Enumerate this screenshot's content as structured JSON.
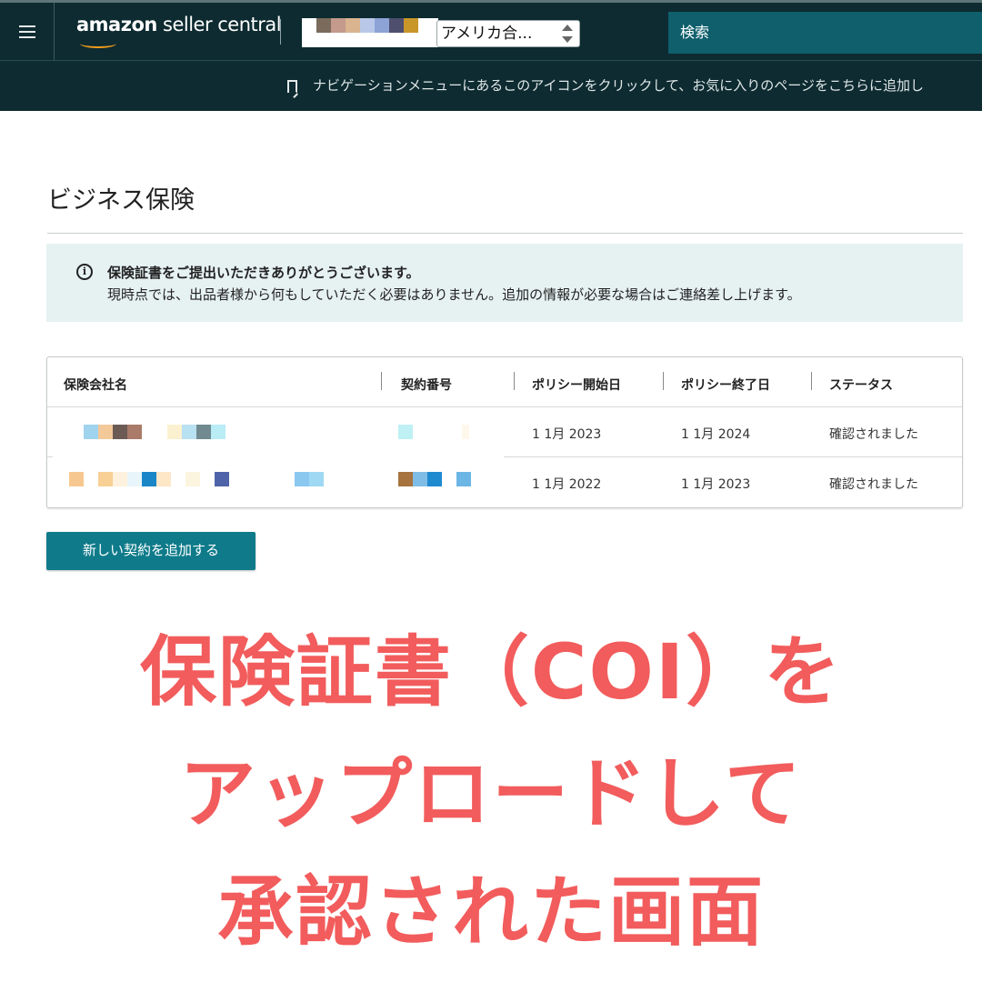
{
  "header": {
    "logo_bold": "amazon",
    "logo_rest": " seller central",
    "marketplace": "アメリカ合...",
    "search_placeholder": "検索"
  },
  "favorites_bar": {
    "hint": "ナビゲーションメニューにあるこのアイコンをクリックして、お気に入りのページをこちらに追加し"
  },
  "page": {
    "title": "ビジネス保険"
  },
  "alert": {
    "title": "保険証書をご提出いただきありがとうございます。",
    "body": "現時点では、出品者様から何もしていただく必要はありません。追加の情報が必要な場合はご連絡差し上げます。"
  },
  "table": {
    "headers": [
      "保険会社名",
      "契約番号",
      "ポリシー開始日",
      "ポリシー終了日",
      "ステータス"
    ],
    "rows": [
      {
        "start": "1 1月 2023",
        "end": "1 1月 2024",
        "status": "確認されました"
      },
      {
        "start": "1 1月 2022",
        "end": "1 1月 2023",
        "status": "確認されました"
      }
    ]
  },
  "actions": {
    "add_contract": "新しい契約を追加する"
  },
  "caption": {
    "line1": "保険証書（COI）を",
    "line2": "アップロードして",
    "line3": "承認された画面"
  },
  "colors": {
    "header_bg": "#0d2b31",
    "search_bg": "#0f5f6d",
    "alert_bg": "#e6f1f2",
    "button_bg": "#0f7b8a",
    "caption": "#f25c5c"
  }
}
